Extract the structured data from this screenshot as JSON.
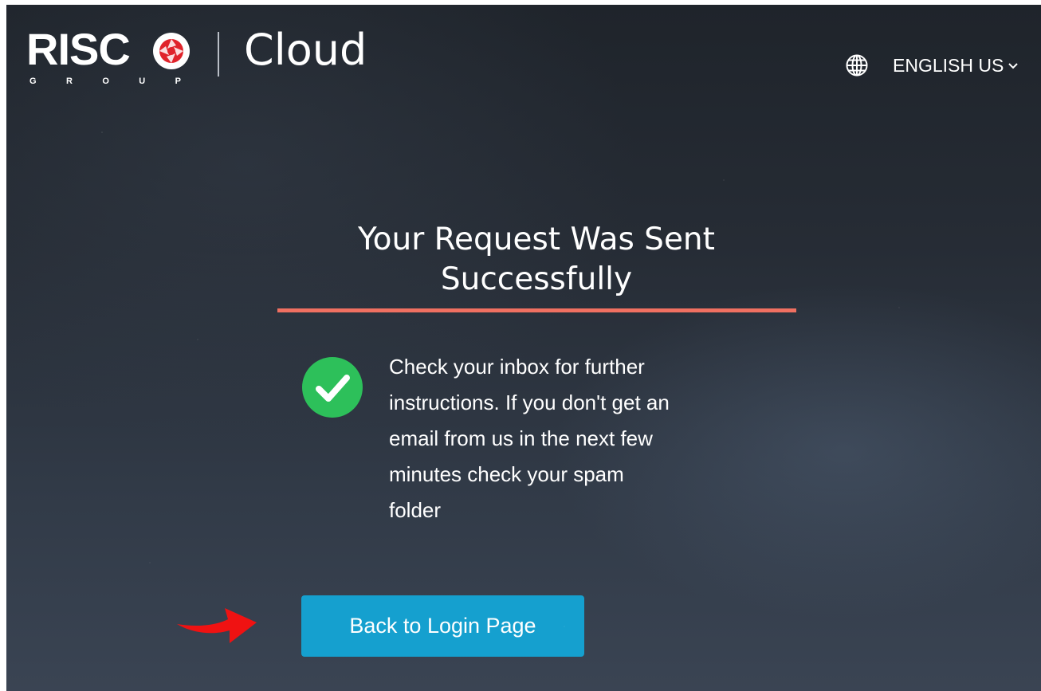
{
  "header": {
    "logo_word": "RISC",
    "logo_sub_letters": [
      "G",
      "R",
      "O",
      "U",
      "P"
    ],
    "app_title": "Cloud",
    "language_label": "ENGLISH US"
  },
  "main": {
    "heading_line1": "Your Request Was Sent",
    "heading_line2": "Successfully",
    "message_lines": [
      "Check your inbox for further",
      "instructions. If you don't get an",
      "email from us in the next few",
      "minutes check your spam",
      "folder"
    ],
    "back_button_label": "Back to Login Page"
  },
  "icons": {
    "logo_mark": "risco-shutter-logo-icon",
    "language": "globe-icon",
    "language_dropdown": "chevron-down-icon",
    "success": "check-circle-icon",
    "pointer": "red-arrow-icon"
  },
  "colors": {
    "accent_underline": "#f07061",
    "button": "#15a0cf",
    "success_green": "#2dc05a",
    "logo_red": "#e0232b",
    "arrow_red": "#f01212"
  }
}
